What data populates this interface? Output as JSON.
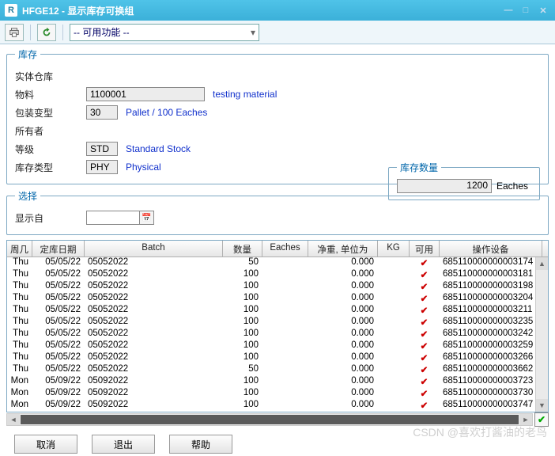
{
  "window": {
    "app_letter": "R",
    "title": "HFGE12 - 显示库存可换组",
    "min": "—",
    "max": "□",
    "close": "✕"
  },
  "toolbar": {
    "print_tip": "打印",
    "refresh_tip": "刷新",
    "func_label": "-- 可用功能 --"
  },
  "kc": {
    "legend": "库存",
    "warehouse_lbl": "实体仓库",
    "material_lbl": "物料",
    "material_val": "1100001",
    "material_desc": "testing material",
    "pack_lbl": "包装变型",
    "pack_val": "30",
    "pack_desc": "Pallet / 100 Eaches",
    "owner_lbl": "所有者",
    "grade_lbl": "等级",
    "grade_val": "STD",
    "grade_desc": "Standard Stock",
    "type_lbl": "库存类型",
    "type_val": "PHY",
    "type_desc": "Physical"
  },
  "qty": {
    "legend": "库存数量",
    "value": "1200",
    "unit": "Eaches"
  },
  "sel": {
    "legend": "选择",
    "showfrom_lbl": "显示自"
  },
  "grid": {
    "headers": {
      "day": "周几",
      "date": "定库日期",
      "batch": "Batch",
      "qty": "数量",
      "unit": "Eaches",
      "netw": "净重, 单位为",
      "kg": "KG",
      "avail": "可用",
      "equip": "操作设备"
    },
    "rows": [
      {
        "day": "Thu",
        "date": "05/05/22",
        "batch": "05052022",
        "qty": "50",
        "unit": "",
        "netw": "0.000",
        "kg": "",
        "avail": "✔",
        "equip": "685110000000003174"
      },
      {
        "day": "Thu",
        "date": "05/05/22",
        "batch": "05052022",
        "qty": "100",
        "unit": "",
        "netw": "0.000",
        "kg": "",
        "avail": "✔",
        "equip": "685110000000003181"
      },
      {
        "day": "Thu",
        "date": "05/05/22",
        "batch": "05052022",
        "qty": "100",
        "unit": "",
        "netw": "0.000",
        "kg": "",
        "avail": "✔",
        "equip": "685110000000003198"
      },
      {
        "day": "Thu",
        "date": "05/05/22",
        "batch": "05052022",
        "qty": "100",
        "unit": "",
        "netw": "0.000",
        "kg": "",
        "avail": "✔",
        "equip": "685110000000003204"
      },
      {
        "day": "Thu",
        "date": "05/05/22",
        "batch": "05052022",
        "qty": "100",
        "unit": "",
        "netw": "0.000",
        "kg": "",
        "avail": "✔",
        "equip": "685110000000003211"
      },
      {
        "day": "Thu",
        "date": "05/05/22",
        "batch": "05052022",
        "qty": "100",
        "unit": "",
        "netw": "0.000",
        "kg": "",
        "avail": "✔",
        "equip": "685110000000003235"
      },
      {
        "day": "Thu",
        "date": "05/05/22",
        "batch": "05052022",
        "qty": "100",
        "unit": "",
        "netw": "0.000",
        "kg": "",
        "avail": "✔",
        "equip": "685110000000003242"
      },
      {
        "day": "Thu",
        "date": "05/05/22",
        "batch": "05052022",
        "qty": "100",
        "unit": "",
        "netw": "0.000",
        "kg": "",
        "avail": "✔",
        "equip": "685110000000003259"
      },
      {
        "day": "Thu",
        "date": "05/05/22",
        "batch": "05052022",
        "qty": "100",
        "unit": "",
        "netw": "0.000",
        "kg": "",
        "avail": "✔",
        "equip": "685110000000003266"
      },
      {
        "day": "Thu",
        "date": "05/05/22",
        "batch": "05052022",
        "qty": "50",
        "unit": "",
        "netw": "0.000",
        "kg": "",
        "avail": "✔",
        "equip": "685110000000003662"
      },
      {
        "day": "Mon",
        "date": "05/09/22",
        "batch": "05092022",
        "qty": "100",
        "unit": "",
        "netw": "0.000",
        "kg": "",
        "avail": "✔",
        "equip": "685110000000003723"
      },
      {
        "day": "Mon",
        "date": "05/09/22",
        "batch": "05092022",
        "qty": "100",
        "unit": "",
        "netw": "0.000",
        "kg": "",
        "avail": "✔",
        "equip": "685110000000003730"
      },
      {
        "day": "Mon",
        "date": "05/09/22",
        "batch": "05092022",
        "qty": "100",
        "unit": "",
        "netw": "0.000",
        "kg": "",
        "avail": "✔",
        "equip": "685110000000003747"
      }
    ]
  },
  "footer": {
    "cancel": "取消",
    "exit": "退出",
    "help": "帮助"
  },
  "watermark": "CSDN @喜欢打酱油的老鸟"
}
